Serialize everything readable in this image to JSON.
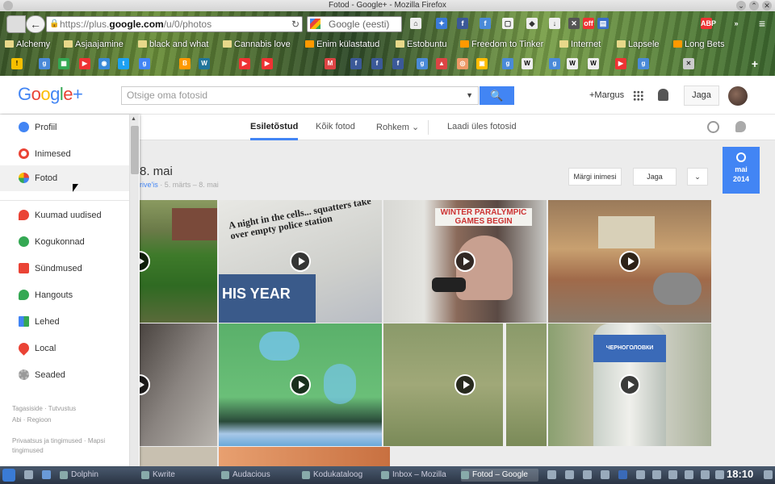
{
  "window": {
    "title": "Fotod - Google+ - Mozilla Firefox"
  },
  "browser": {
    "url_prefix": "https://plus.",
    "url_domain": "google.com",
    "url_path": "/u/0/photos",
    "search_placeholder": "Google (eesti)",
    "bookmarks": [
      {
        "label": "Alchemy"
      },
      {
        "label": "Asjaajamine"
      },
      {
        "label": "black and what"
      },
      {
        "label": "Cannabis love"
      },
      {
        "label": "Enim külastatud"
      },
      {
        "label": "Estobuntu"
      },
      {
        "label": "Freedom to Tinker"
      },
      {
        "label": "Internet"
      },
      {
        "label": "Lapsele"
      },
      {
        "label": "Long Bets"
      }
    ]
  },
  "gplus": {
    "logo_text": "Google+",
    "search_placeholder": "Otsige oma fotosid",
    "user_label": "+Margus",
    "share_label": "Jaga"
  },
  "sidebar": {
    "items": [
      {
        "label": "Profiil",
        "icon": "profile-icon",
        "color": "#4285f4"
      },
      {
        "label": "Inimesed",
        "icon": "people-icon",
        "color": "#ea4335"
      },
      {
        "label": "Fotod",
        "icon": "photos-icon",
        "color": "#fbbc05"
      },
      {
        "label": "Kuumad uudised",
        "icon": "flame-icon",
        "color": "#ea4335"
      },
      {
        "label": "Kogukonnad",
        "icon": "communities-icon",
        "color": "#34a853"
      },
      {
        "label": "Sündmused",
        "icon": "calendar-icon",
        "color": "#ea4335"
      },
      {
        "label": "Hangouts",
        "icon": "hangouts-icon",
        "color": "#34a853"
      },
      {
        "label": "Lehed",
        "icon": "pages-icon",
        "color": "#4285f4"
      },
      {
        "label": "Local",
        "icon": "pin-icon",
        "color": "#ea4335"
      },
      {
        "label": "Seaded",
        "icon": "gear-icon",
        "color": "#999999"
      }
    ],
    "footer": {
      "line1": "Tagasiside · Tutvustus",
      "line2": "Abi · Regioon",
      "line3": "Privaatsus ja tingimused · Mapsi tingimused"
    }
  },
  "tabs": {
    "featured": "Esiletõstud",
    "all": "Kõik fotod",
    "more": "Rohkem ⌄",
    "upload": "Laadi üles fotosid"
  },
  "album": {
    "title": "8. mai",
    "author": "rive'is",
    "dates": "· 5. märts – 8. mai",
    "tag_people": "Märgi inimesi",
    "share": "Jaga",
    "more": "⌄"
  },
  "date_badge": {
    "month": "mai",
    "year": "2014"
  },
  "photos": [
    {
      "name": "photo-garden",
      "video": true
    },
    {
      "name": "photo-newspaper-squatters",
      "video": true,
      "headline": "A night in the cells... squatters take over empty police station",
      "subline": "HIS YEAR"
    },
    {
      "name": "photo-newspaper-putin",
      "video": true,
      "headline": "WINTER PARALYMPIC GAMES BEGIN"
    },
    {
      "name": "photo-kitchen",
      "video": true
    },
    {
      "name": "photo-blur",
      "video": true
    },
    {
      "name": "photo-bees",
      "video": true
    },
    {
      "name": "photo-grass",
      "video": true
    },
    {
      "name": "photo-bottle",
      "video": true,
      "label": "ЧЕРНОГОЛОВКИ"
    }
  ],
  "taskbar": {
    "tasks": [
      {
        "label": "Dolphin"
      },
      {
        "label": "Kwrite"
      },
      {
        "label": "Audacious"
      },
      {
        "label": "Kodukataloog"
      },
      {
        "label": "Inbox – Mozilla"
      },
      {
        "label": "Fotod – Google"
      }
    ],
    "clock": "18:10"
  }
}
